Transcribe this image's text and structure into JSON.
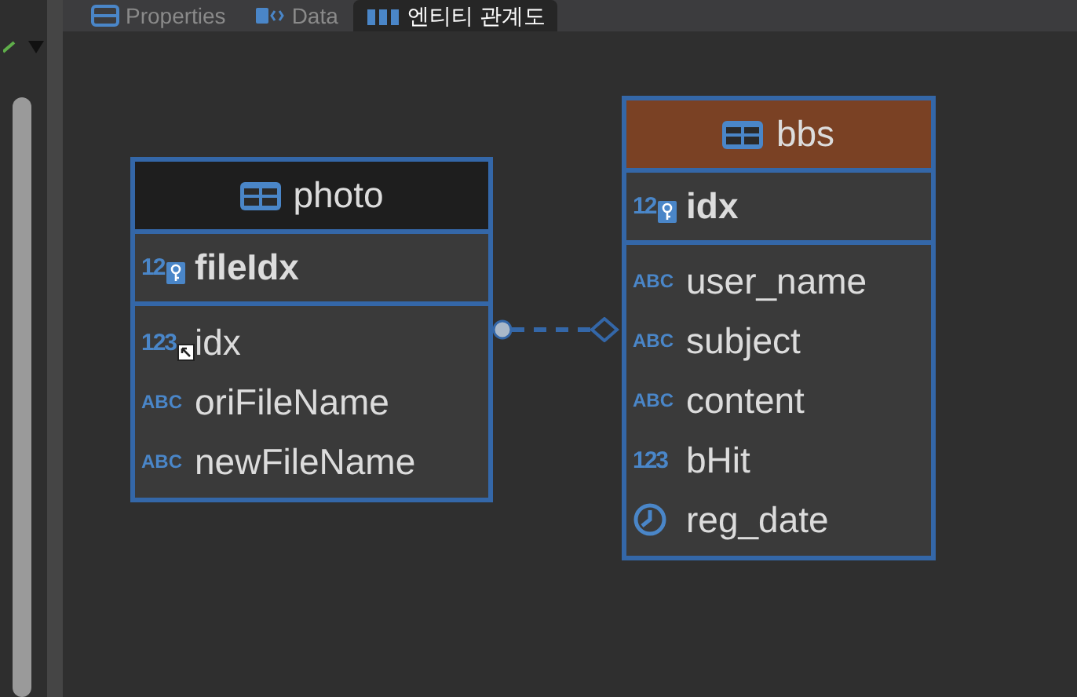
{
  "tabs": [
    {
      "label": "Properties",
      "kind": "properties",
      "selected": false
    },
    {
      "label": "Data",
      "kind": "data",
      "selected": false
    },
    {
      "label": "엔티티 관계도",
      "kind": "diagram",
      "selected": true
    }
  ],
  "tables": [
    {
      "name": "photo",
      "color": "#1e1e1e",
      "keys": [
        {
          "name": "fileIdx",
          "type_label": "12"
        }
      ],
      "columns": [
        {
          "name": "idx",
          "kind": "label",
          "type_label": "123",
          "foreign_key": true
        },
        {
          "name": "oriFileName",
          "kind": "label",
          "type_label": "ABC",
          "foreign_key": false
        },
        {
          "name": "newFileName",
          "kind": "label",
          "type_label": "ABC",
          "foreign_key": false
        }
      ]
    },
    {
      "name": "bbs",
      "color": "#7a4124",
      "keys": [
        {
          "name": "idx",
          "type_label": "12"
        }
      ],
      "columns": [
        {
          "name": "user_name",
          "kind": "label",
          "type_label": "ABC",
          "foreign_key": false
        },
        {
          "name": "subject",
          "kind": "label",
          "type_label": "ABC",
          "foreign_key": false
        },
        {
          "name": "content",
          "kind": "label",
          "type_label": "ABC",
          "foreign_key": false
        },
        {
          "name": "bHit",
          "kind": "label",
          "type_label": "123",
          "foreign_key": false
        },
        {
          "name": "reg_date",
          "kind": "clock",
          "foreign_key": false
        }
      ]
    }
  ]
}
